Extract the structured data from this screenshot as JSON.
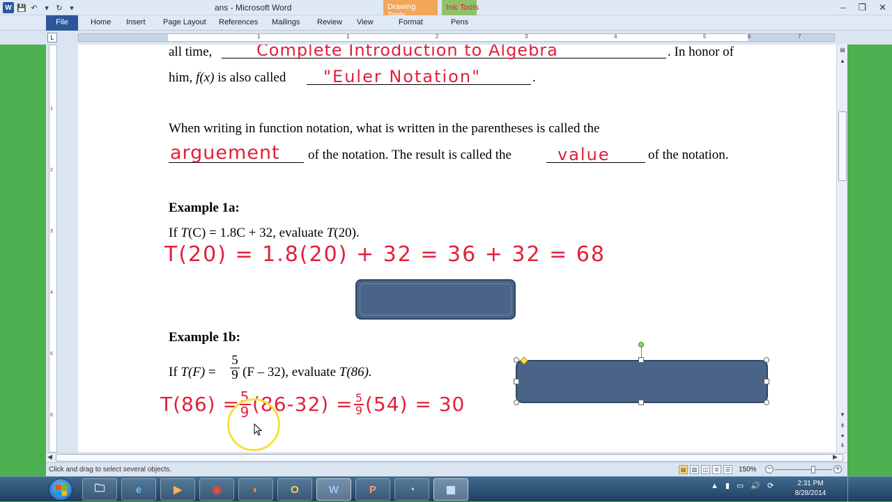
{
  "window": {
    "title": "ans - Microsoft Word",
    "context_tabs": [
      "Drawing Tools",
      "Ink Tools"
    ],
    "controls": [
      "–",
      "❐",
      "✕"
    ]
  },
  "quick_access": [
    "W",
    "💾",
    "↶",
    "▾",
    "↻",
    "▾"
  ],
  "ribbon": {
    "file_tab": "File",
    "tabs": [
      "Home",
      "Insert",
      "Page Layout",
      "References",
      "Mailings",
      "Review",
      "View",
      "Format",
      "Pens"
    ]
  },
  "ruler": {
    "corner_symbol": "L",
    "h_numbers": [
      "1",
      "1",
      "2",
      "3",
      "4",
      "5",
      "6",
      "7"
    ],
    "v_numbers": [
      "1",
      "2",
      "3",
      "4",
      "5",
      "6"
    ]
  },
  "document": {
    "line1_text": "all time,",
    "line1_end": ".  In honor of",
    "line2_text": "him, ",
    "line2_fx": "f(x)",
    "line2_rest": " is also called",
    "line2_end": ".",
    "para2_line1": "When writing in function notation, what is written in the parentheses is called the",
    "para2_mid": "of the notation.  The result is called the",
    "para2_end": "of the notation.",
    "example1a_heading": "Example 1a:",
    "example1a_prompt_pre": "If ",
    "example1a_T": "T",
    "example1a_prompt_mid": "(C) = 1.8C + 32, evaluate ",
    "example1a_T2": "T",
    "example1a_prompt_end": "(20).",
    "example1b_heading": "Example 1b:",
    "example1b_if": "If ",
    "example1b_TF": "T(F)",
    "example1b_eq": " = ",
    "example1b_num": "5",
    "example1b_den": "9",
    "example1b_rest": "(F – 32), evaluate ",
    "example1b_T86": "T(86)."
  },
  "ink": {
    "blank1": "Complete Introduction to Algebra",
    "blank2": "\"Euler Notation\"",
    "blank3": "arguement",
    "blank4": "value",
    "work1a": "T(20) = 1.8(20) + 32  =  36 + 32  = 68",
    "work1b_left": "T(86) =",
    "work1b_frac_num": "5",
    "work1b_frac_den": "9",
    "work1b_mid": "(86-32)  =",
    "work1b_frac2_num": "5",
    "work1b_frac2_den": "9",
    "work1b_end": "(54) =  30",
    "ink_color": "#e0203a"
  },
  "statusbar": {
    "message": "Click and drag to select several objects.",
    "zoom": "150%",
    "zoom_level": 150
  },
  "taskbar": {
    "clock_time": "2:31 PM",
    "clock_date": "8/28/2014",
    "apps": [
      "folder-icon",
      "internet-explorer-icon",
      "media-player-icon",
      "chrome-icon",
      "firefox-icon",
      "outlook-icon",
      "word-icon",
      "powerpoint-icon",
      "network-icon",
      "snipping-icon"
    ],
    "app_glyphs": [
      "🗀",
      "e",
      "▶",
      "◉",
      "◐",
      "O",
      "W",
      "P",
      "◔",
      "▦"
    ]
  }
}
